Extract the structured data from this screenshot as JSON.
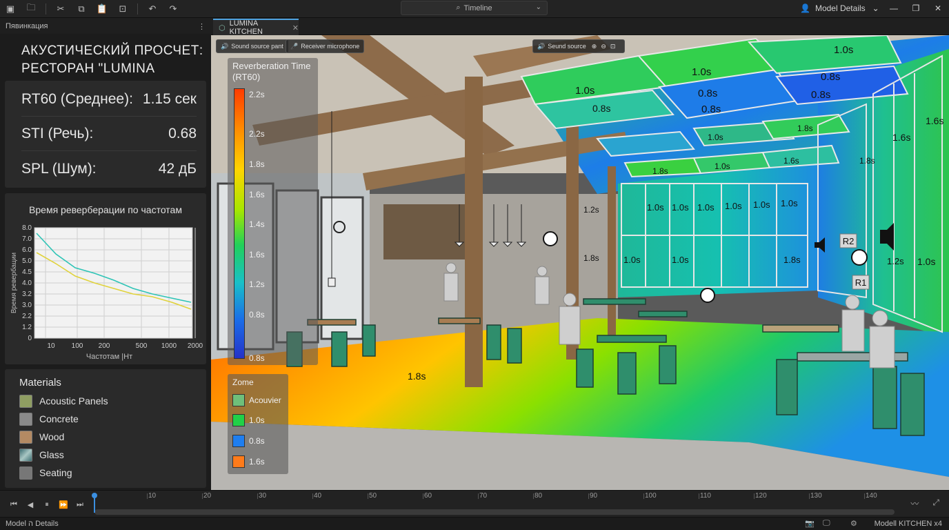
{
  "topbar": {
    "icons": [
      "app-logo-icon",
      "folder-icon",
      "cut-icon",
      "copy-icon",
      "paste-icon",
      "inspect-icon",
      "undo-icon",
      "redo-icon"
    ],
    "timeline_label": "Timeline",
    "model_details_label": "Model Details"
  },
  "left_panel": {
    "header": "Пявинкация",
    "report_title_line1": "АКУСТИЧЕСКИЙ ПРОСЧЕТ:",
    "report_title_line2": "РЕСТОРАН \"LUMINA KITCHEN\"",
    "metrics": [
      {
        "label": "RT60 (Среднее):",
        "value": "1.15 сек"
      },
      {
        "label": "STI (Речь):",
        "value": "0.68"
      },
      {
        "label": "SPL (Шум):",
        "value": "42 дБ"
      }
    ]
  },
  "chart_data": {
    "type": "line",
    "title": "Время реверберации по частотам",
    "xlabel": "Частотам |Нт",
    "ylabel": "Время ревербации",
    "x_tick_labels": [
      "10",
      "100",
      "200",
      "500",
      "1000",
      "2000"
    ],
    "y_tick_labels": [
      "0",
      "1.2",
      "2.2",
      "3.0",
      "3.2",
      "4.0",
      "4.5",
      "5.0",
      "6.0",
      "7.0",
      "8.0"
    ],
    "ylim": [
      0,
      8
    ],
    "series": [
      {
        "color": "#2ec4b6",
        "values": [
          7.6,
          6.1,
          5.1,
          4.7,
          4.2,
          3.6,
          3.2,
          2.9,
          2.6
        ]
      },
      {
        "color": "#e0d23a",
        "values": [
          6.2,
          5.4,
          4.5,
          4.0,
          3.6,
          3.2,
          3.0,
          2.6,
          2.1
        ]
      }
    ]
  },
  "materials": {
    "title": "Materials",
    "items": [
      {
        "label": "Acoustic Panels",
        "color": "#8f9e62"
      },
      {
        "label": "Concrete",
        "color": "#8a8a8a"
      },
      {
        "label": "Wood",
        "color": "#b48a63"
      },
      {
        "label": "Glass",
        "color": "#5f8a8c"
      },
      {
        "label": "Seating",
        "color": "#777777"
      }
    ]
  },
  "tab": {
    "label": "LUMINA KITCHEN"
  },
  "viewport": {
    "buttons": {
      "sound_source_paint": "Sound source pant",
      "receiver_microphone": "Receiver microphone",
      "sound_source": "Seund source"
    },
    "legend": {
      "title_line1": "Reverberation Time",
      "title_line2": "(RT60)",
      "ticks": [
        "2.2s",
        "2.2s",
        "1.8s",
        "1.6s",
        "1.4s",
        "1.6s",
        "1.2s",
        "0.8s",
        "0.8s"
      ]
    },
    "zones": {
      "title": "Zome",
      "items": [
        {
          "label": "Acouvier",
          "color": "#6fbf7a"
        },
        {
          "label": "1.0s",
          "color": "#21d048"
        },
        {
          "label": "0.8s",
          "color": "#1e7ef0"
        },
        {
          "label": "1.6s",
          "color": "#ff7b1a"
        }
      ]
    },
    "markers": {
      "r1": "R1",
      "r2": "R2"
    },
    "labels": {
      "floor": "1.8s",
      "c1": "1.0s",
      "c2": "1.0s",
      "c3": "1.0s",
      "c4": "0.8s",
      "c5": "0.8s",
      "c6": "0.8s",
      "c7": "0.8s",
      "c8": "0.8s",
      "c9": "1.8s",
      "c10": "1.0s",
      "c11": "1.6s",
      "c12": "1.8s",
      "c13": "1.0s",
      "w1": "1.0s",
      "w2": "1.0s",
      "w3": "1.0s",
      "w4": "1.0s",
      "w5": "1.0s",
      "w6": "1.0s",
      "w7": "1.0s",
      "w8": "1.0s",
      "w9": "1.8s",
      "w10": "1.2s",
      "w11": "1.8s",
      "r_a": "1.6s",
      "r_b": "1.6s",
      "r_c": "1.8s",
      "r_d": "1.0s",
      "r_e": "1.2s"
    }
  },
  "timeline": {
    "ticks": [
      "10",
      "20",
      "30",
      "40",
      "50",
      "60",
      "70",
      "80",
      "90",
      "100",
      "110",
      "120",
      "130",
      "140"
    ]
  },
  "status": {
    "left": "Model ה Details",
    "right": "Modell KITCHEN x4"
  }
}
